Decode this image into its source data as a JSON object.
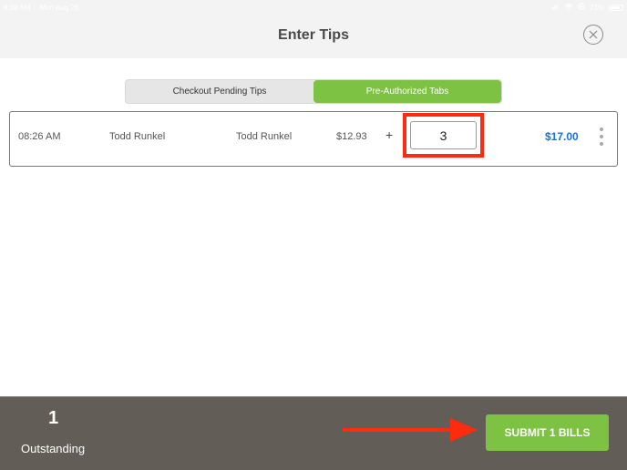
{
  "status_bar": {
    "time": "8:39 AM",
    "date": "Mon Aug 26",
    "battery": "73%",
    "icons": [
      "signal-icon",
      "wifi-icon",
      "orientation-lock-icon",
      "battery-icon"
    ]
  },
  "header": {
    "title": "Enter Tips",
    "close_icon": "close-circle-icon"
  },
  "tabs": [
    {
      "label": "Checkout Pending Tips",
      "active": false
    },
    {
      "label": "Pre-Authorized Tabs",
      "active": true
    }
  ],
  "tip_rows": [
    {
      "time": "08:26 AM",
      "server": "Todd Runkel",
      "customer": "Todd Runkel",
      "amount": "$12.93",
      "plus": "+",
      "tip_value": "3",
      "total": "$17.00",
      "more_icon": "more-vertical-icon"
    }
  ],
  "footer": {
    "outstanding_count": "1",
    "outstanding_label": "Outstanding",
    "submit_label": "SUBMIT 1 BILLS"
  },
  "annotations": {
    "highlight_color": "#ff2b0e",
    "arrow_color": "#ff2b0e"
  },
  "colors": {
    "accent_green": "#7dc242",
    "total_blue": "#1a6fe0",
    "footer_bg": "#625e57",
    "header_bg": "#f3f3f3"
  }
}
